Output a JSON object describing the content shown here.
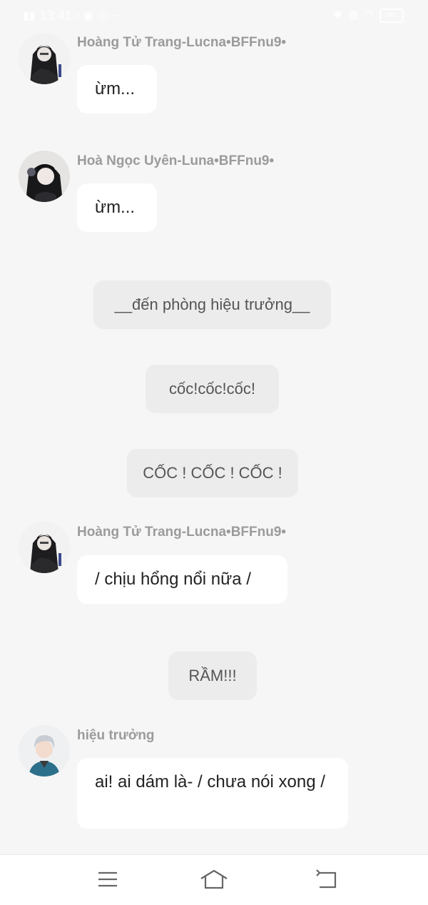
{
  "status_bar": {
    "time": "13:41",
    "battery": "88"
  },
  "messages": [
    {
      "sender": "Hoàng Tử Trang-Lucna•BFFnu9•",
      "text": "ừm..."
    },
    {
      "sender": "Hoà Ngọc Uyên-Luna•BFFnu9•",
      "text": "ừm..."
    },
    {
      "narration": "__đến phòng hiệu trưởng__"
    },
    {
      "narration": "cốc!cốc!cốc!"
    },
    {
      "narration": "CỐC ! CỐC ! CỐC !"
    },
    {
      "sender": "Hoàng Tử Trang-Lucna•BFFnu9•",
      "text": "/ chịu hổng nổi nữa /"
    },
    {
      "narration": "RẦM!!!"
    },
    {
      "sender": "hiệu trưởng",
      "text": "ai! ai dám là- / chưa nói xong /"
    }
  ],
  "colors": {
    "background": "#f6f6f6",
    "bubble": "#ffffff",
    "narration_bubble": "#ececec",
    "sender_name": "#9b9b9b"
  },
  "nav_bar": {
    "icons": [
      "menu-icon",
      "home-icon",
      "back-icon"
    ]
  }
}
